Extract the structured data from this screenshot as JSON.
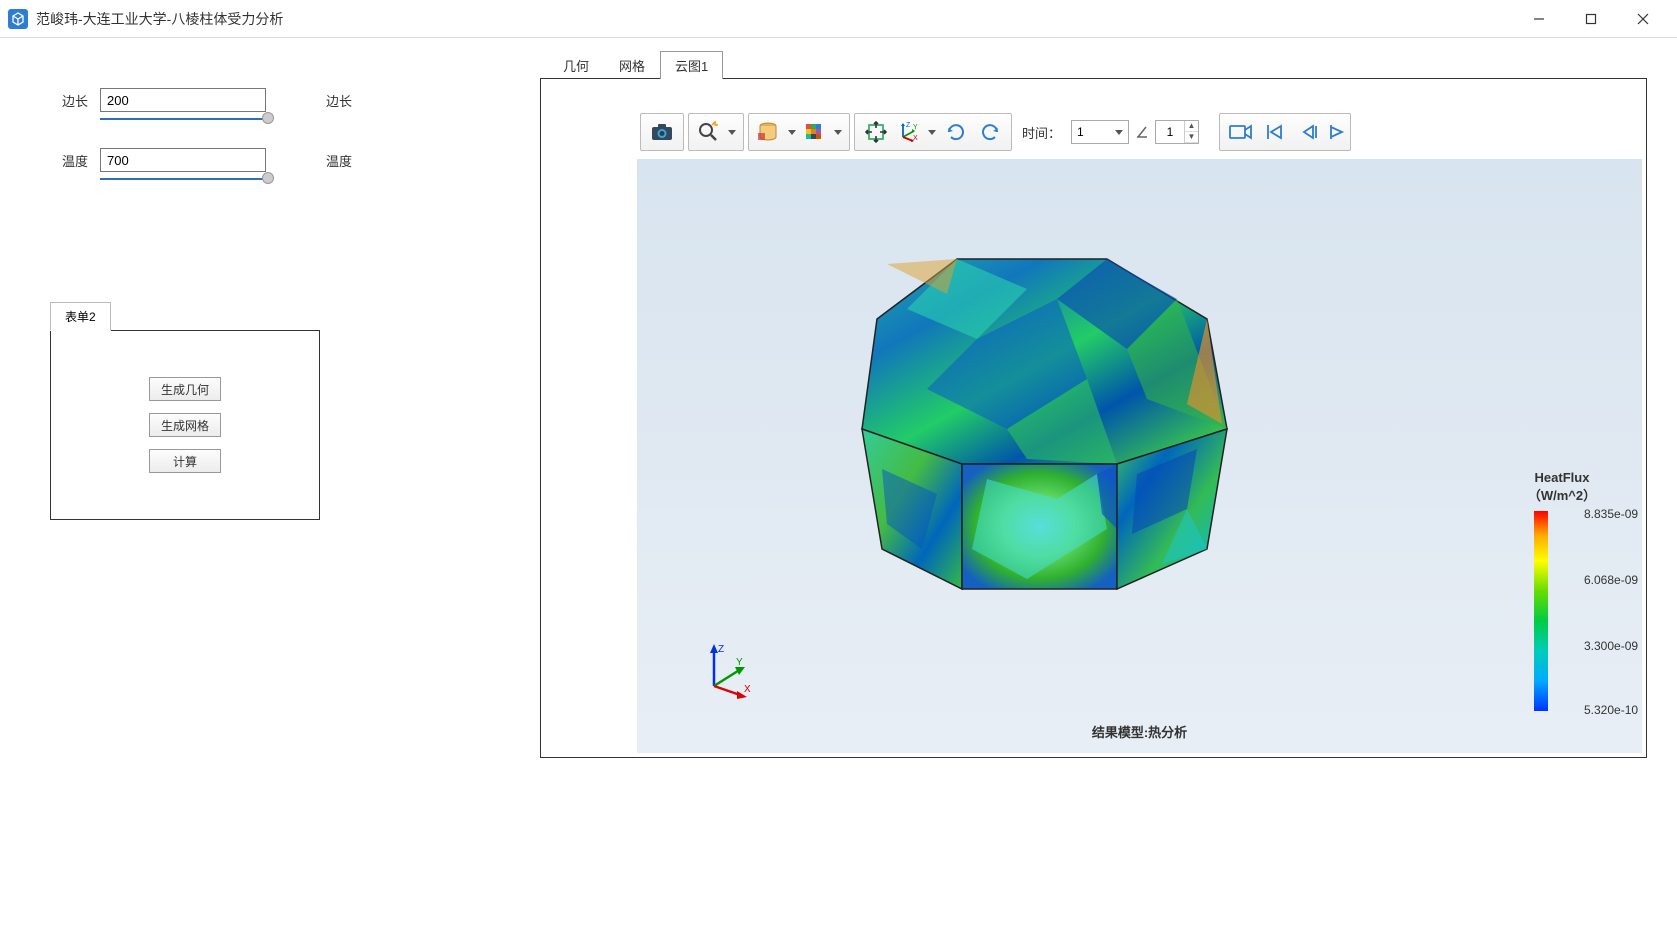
{
  "title": "范峻玮-大连工业大学-八棱柱体受力分析",
  "params": {
    "edge_label": "边长",
    "edge_value": "200",
    "edge_unit": "边长",
    "temp_label": "温度",
    "temp_value": "700",
    "temp_unit": "温度"
  },
  "form": {
    "tab_label": "表单2",
    "btn_geometry": "生成几何",
    "btn_mesh": "生成网格",
    "btn_compute": "计算"
  },
  "tabs": {
    "geom": "几何",
    "mesh": "网格",
    "cloud": "云图1"
  },
  "toolbar": {
    "time_label": "时间：",
    "time_select_value": "1",
    "time_spinner_value": "1"
  },
  "scene": {
    "caption": "结果模型:热分析",
    "triad": {
      "x": "X",
      "y": "Y",
      "z": "Z"
    }
  },
  "colorbar": {
    "title_line1": "HeatFlux",
    "title_line2": "（W/m^2）",
    "ticks": [
      "8.835e-09",
      "6.068e-09",
      "3.300e-09",
      "5.320e-10"
    ]
  }
}
